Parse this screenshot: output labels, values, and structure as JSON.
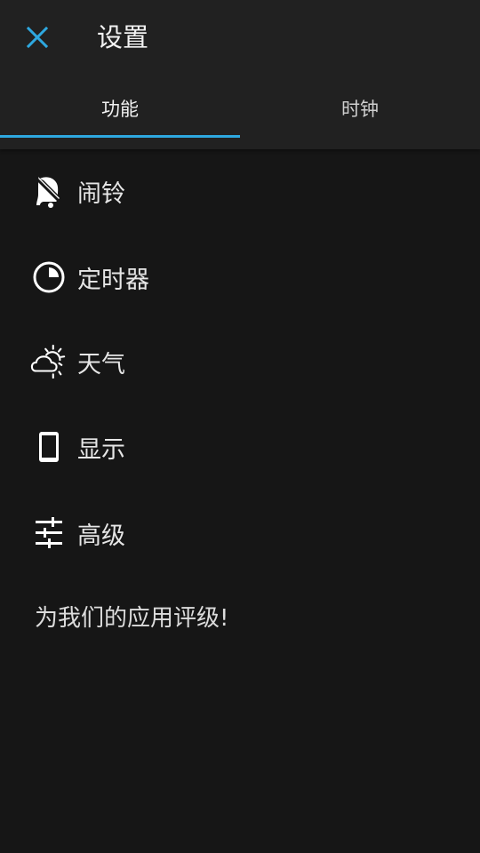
{
  "header": {
    "title": "设置",
    "close_icon": "close-icon",
    "accent_color": "#2ea8e0"
  },
  "tabs": [
    {
      "label": "功能",
      "active": true
    },
    {
      "label": "时钟",
      "active": false
    }
  ],
  "menu": {
    "items": [
      {
        "label": "闹铃",
        "icon": "alarm-off-icon"
      },
      {
        "label": "定时器",
        "icon": "timer-icon"
      },
      {
        "label": "天气",
        "icon": "weather-icon"
      },
      {
        "label": "显示",
        "icon": "phone-icon"
      },
      {
        "label": "高级",
        "icon": "sliders-icon"
      }
    ]
  },
  "rate_link": "为我们的应用评级!"
}
